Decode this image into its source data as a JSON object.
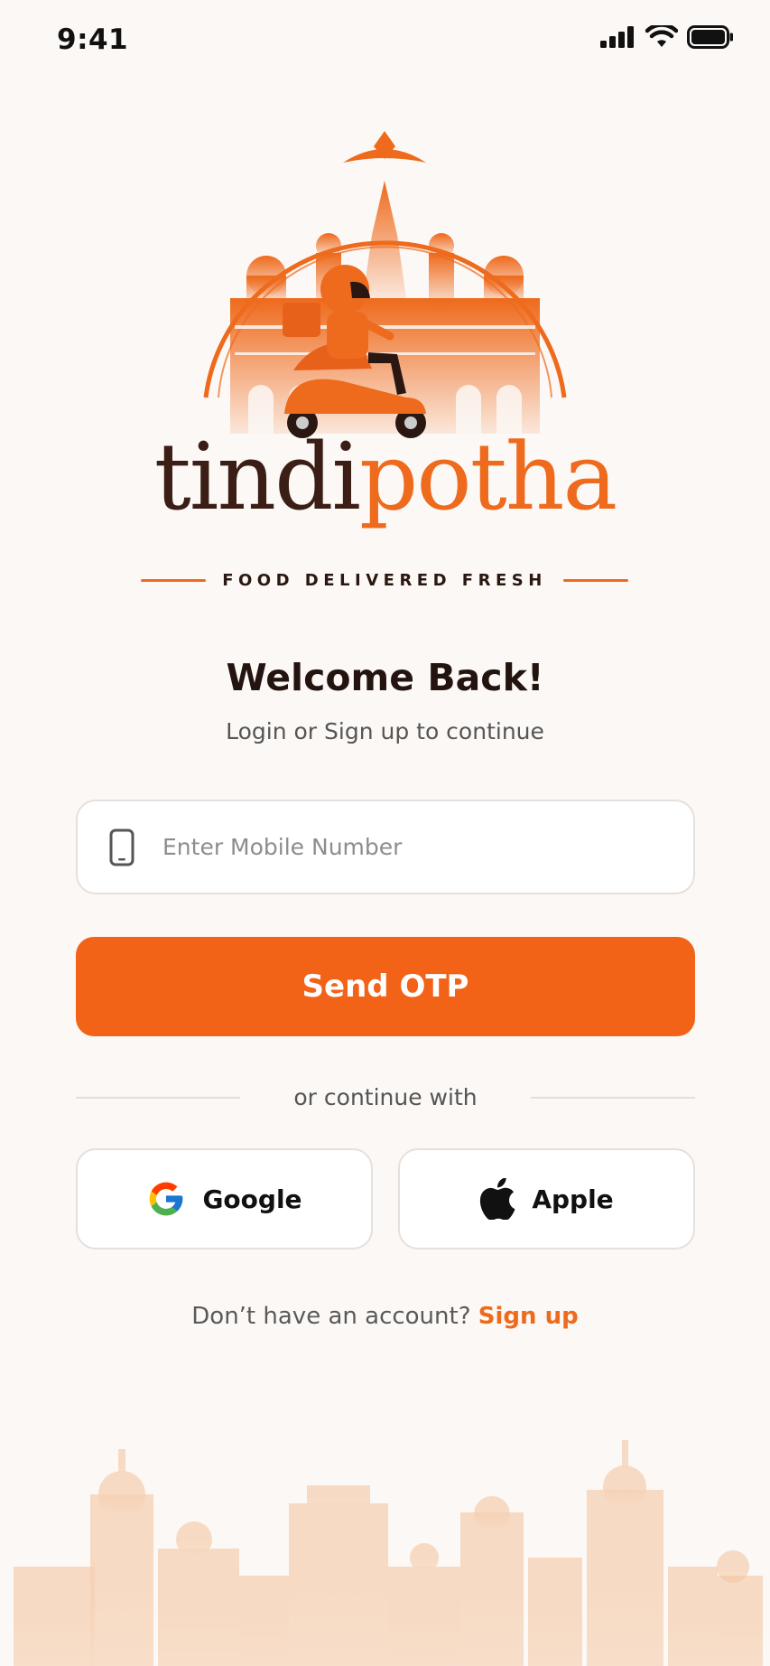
{
  "status_bar": {
    "time": "9:41"
  },
  "brand": {
    "name_part1": "tindi",
    "name_part2": "potha",
    "tagline": "FOOD DELIVERED FRESH",
    "accent_color": "#EE6A1C",
    "dark_color": "#3B1E15"
  },
  "welcome": {
    "title": "Welcome Back!",
    "subtitle": "Login or Sign up to continue"
  },
  "phone_field": {
    "placeholder": "Enter Mobile Number",
    "value": ""
  },
  "otp_button": {
    "label": "Send OTP",
    "color": "#F26217"
  },
  "divider": {
    "text": "or continue with"
  },
  "social": {
    "google_label": "Google",
    "apple_label": "Apple"
  },
  "signup": {
    "prompt": "Don’t have an account?",
    "link": "Sign up"
  },
  "icons": [
    "signal-icon",
    "wifi-icon",
    "battery-icon",
    "mobile-phone-icon",
    "google-icon",
    "apple-icon"
  ]
}
